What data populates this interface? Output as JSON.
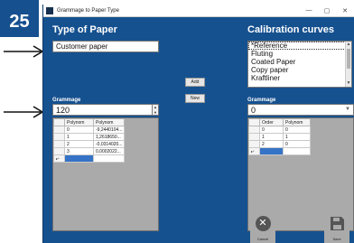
{
  "step_badge": "25",
  "window": {
    "title": "Grammage to Paper Type",
    "minimize": "—",
    "close": "✕"
  },
  "left": {
    "heading": "Type of Paper",
    "paper_value": "Customer paper",
    "grammage_label": "Grammage",
    "grammage_value": "120",
    "grid": {
      "columns": [
        "Polynom",
        "Polynom"
      ],
      "rows": [
        [
          "0",
          "-9,2440104..."
        ],
        [
          "1",
          "1,2618650..."
        ],
        [
          "2",
          "-0,0314020..."
        ],
        [
          "3",
          "0,0002022..."
        ]
      ],
      "new_row_marker": "▸*"
    }
  },
  "middle": {
    "add_label": "Add",
    "new_label": "New"
  },
  "right": {
    "heading": "Calibration curves",
    "curves": [
      "*Reference",
      "Fluting",
      "Coated Paper",
      "Copy paper",
      "Kraftliner"
    ],
    "grammage_label": "Grammage",
    "grammage_value": "0",
    "grid": {
      "columns": [
        "Order",
        "Polynom"
      ],
      "rows": [
        [
          "0",
          "0"
        ],
        [
          "1",
          "1"
        ],
        [
          "2",
          "0"
        ]
      ],
      "new_row_marker": "▸*"
    }
  },
  "buttons": {
    "cancel_label": "Cancel",
    "save_label": "Save"
  },
  "colors": {
    "window_bg": "#16518f",
    "badge_bg": "#16508f"
  },
  "icons": {
    "cancel": "x-circle-icon",
    "save": "floppy-disk-icon",
    "arrows": "arrow-right-icon"
  }
}
